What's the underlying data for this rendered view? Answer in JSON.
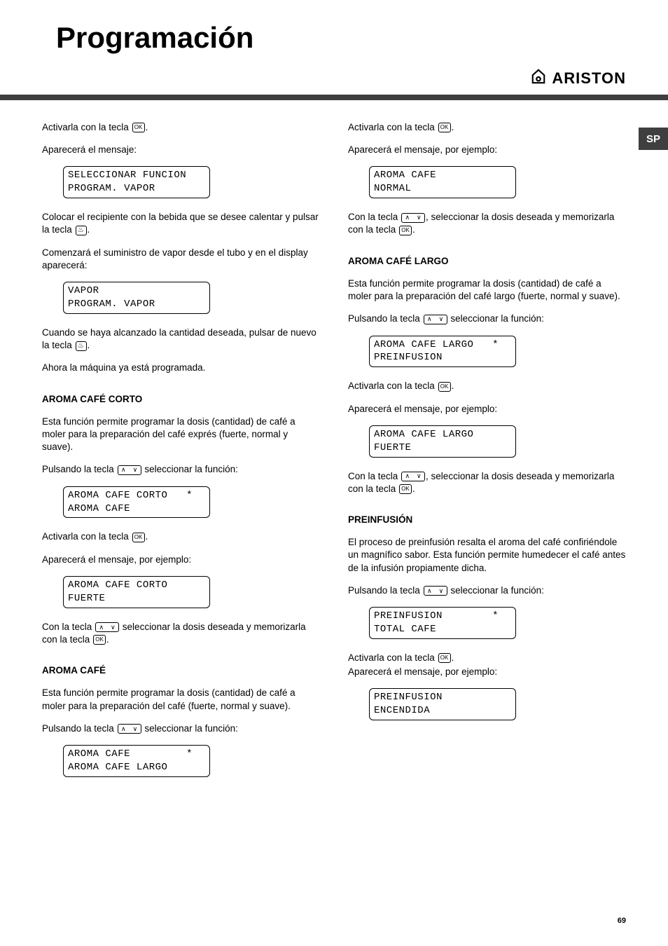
{
  "title": "Programación",
  "brand": "ARISTON",
  "sideTab": "SP",
  "pageNumber": "69",
  "icons": {
    "ok": "OK",
    "steam": "♨"
  },
  "left": {
    "p1a": "Activarla con la tecla ",
    "p1b": ".",
    "p2": "Aparecerá el mensaje:",
    "lcd1": {
      "l1": "SELECCIONAR FUNCION",
      "l2": "PROGRAM. VAPOR"
    },
    "p3a": "Colocar el recipiente con la bebida que se desee calentar y pulsar la tecla ",
    "p3b": ".",
    "p4": "Comenzará el suministro de vapor desde el tubo y en el display aparecerá:",
    "lcd2": {
      "l1": "VAPOR",
      "l2": "PROGRAM. VAPOR"
    },
    "p5a": "Cuando se haya alcanzado la cantidad deseada, pulsar de nuevo la tecla ",
    "p5b": ".",
    "p6": "Ahora la máquina ya está programada.",
    "h1": "AROMA CAFÉ CORTO",
    "p7": "Esta función permite programar la dosis (cantidad) de café a moler para la preparación del café exprés (fuerte, normal y suave).",
    "p8a": "Pulsando la tecla ",
    "p8b": " seleccionar la función:",
    "lcd3": {
      "l1": "AROMA CAFE CORTO   *",
      "l2": "AROMA CAFE"
    },
    "p9a": "Activarla con la tecla ",
    "p9b": ".",
    "p10": "Aparecerá el mensaje, por ejemplo:",
    "lcd4": {
      "l1": "AROMA CAFE CORTO",
      "l2": "FUERTE"
    },
    "p11a": "Con la tecla ",
    "p11b": " seleccionar la dosis deseada y memorizarla con la tecla ",
    "p11c": ".",
    "h2": "AROMA CAFÉ",
    "p12": "Esta función permite programar la dosis (cantidad) de café a moler para la preparación del café (fuerte, normal y suave).",
    "p13a": "Pulsando la tecla ",
    "p13b": " seleccionar la función:",
    "lcd5": {
      "l1": "AROMA CAFE         *",
      "l2": "AROMA CAFE LARGO"
    }
  },
  "right": {
    "p1a": "Activarla con la tecla ",
    "p1b": ".",
    "p2": "Aparecerá el mensaje, por ejemplo:",
    "lcd1": {
      "l1": "AROMA CAFE",
      "l2": "NORMAL"
    },
    "p3a": "Con la tecla ",
    "p3b": ", seleccionar la dosis deseada y memorizarla con la tecla ",
    "p3c": ".",
    "h1": "AROMA CAFÉ LARGO",
    "p4": "Esta función permite programar la dosis (cantidad) de café a moler para la preparación del café largo (fuerte, normal y suave).",
    "p5a": "Pulsando la tecla ",
    "p5b": " seleccionar la función:",
    "lcd2": {
      "l1": "AROMA CAFE LARGO   *",
      "l2": "PREINFUSION"
    },
    "p6a": "Activarla con la tecla ",
    "p6b": ".",
    "p7": "Aparecerá el mensaje, por ejemplo:",
    "lcd3": {
      "l1": "AROMA CAFE LARGO",
      "l2": "FUERTE"
    },
    "p8a": "Con la tecla ",
    "p8b": ", seleccionar la dosis deseada y memorizarla con la tecla ",
    "p8c": ".",
    "h2": "PREINFUSIÓN",
    "p9": "El proceso de preinfusión resalta el aroma del café confiriéndole un magnífico sabor. Esta función permite humedecer el café antes de la infusión propiamente dicha.",
    "p10a": "Pulsando la tecla ",
    "p10b": " seleccionar la función:",
    "lcd4": {
      "l1": "PREINFUSION        *",
      "l2": "TOTAL CAFE"
    },
    "p11a": "Activarla con la tecla ",
    "p11b": ".",
    "p12": "Aparecerá el mensaje, por ejemplo:",
    "lcd5": {
      "l1": "PREINFUSION",
      "l2": "ENCENDIDA"
    }
  }
}
